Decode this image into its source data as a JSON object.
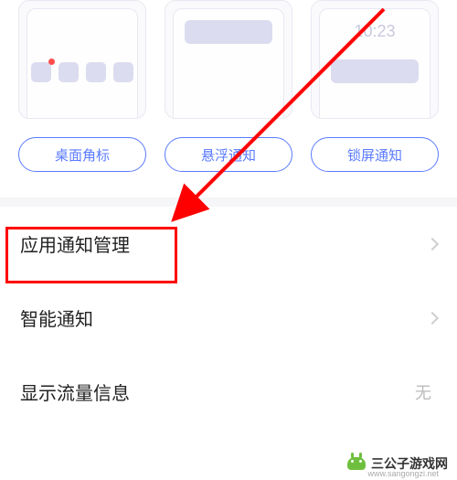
{
  "previews": {
    "lock_time": "10:23"
  },
  "pills": {
    "desktop_badge": "桌面角标",
    "floating": "悬浮通知",
    "lockscreen": "锁屏通知"
  },
  "list": {
    "app_notif_mgmt": "应用通知管理",
    "smart_notif": "智能通知",
    "show_traffic": "显示流量信息",
    "show_traffic_value": "无"
  },
  "watermark": {
    "text": "三公子游戏网",
    "url": "www.sangongzi.net"
  },
  "annotation": {
    "highlight_color": "#ff0000"
  }
}
